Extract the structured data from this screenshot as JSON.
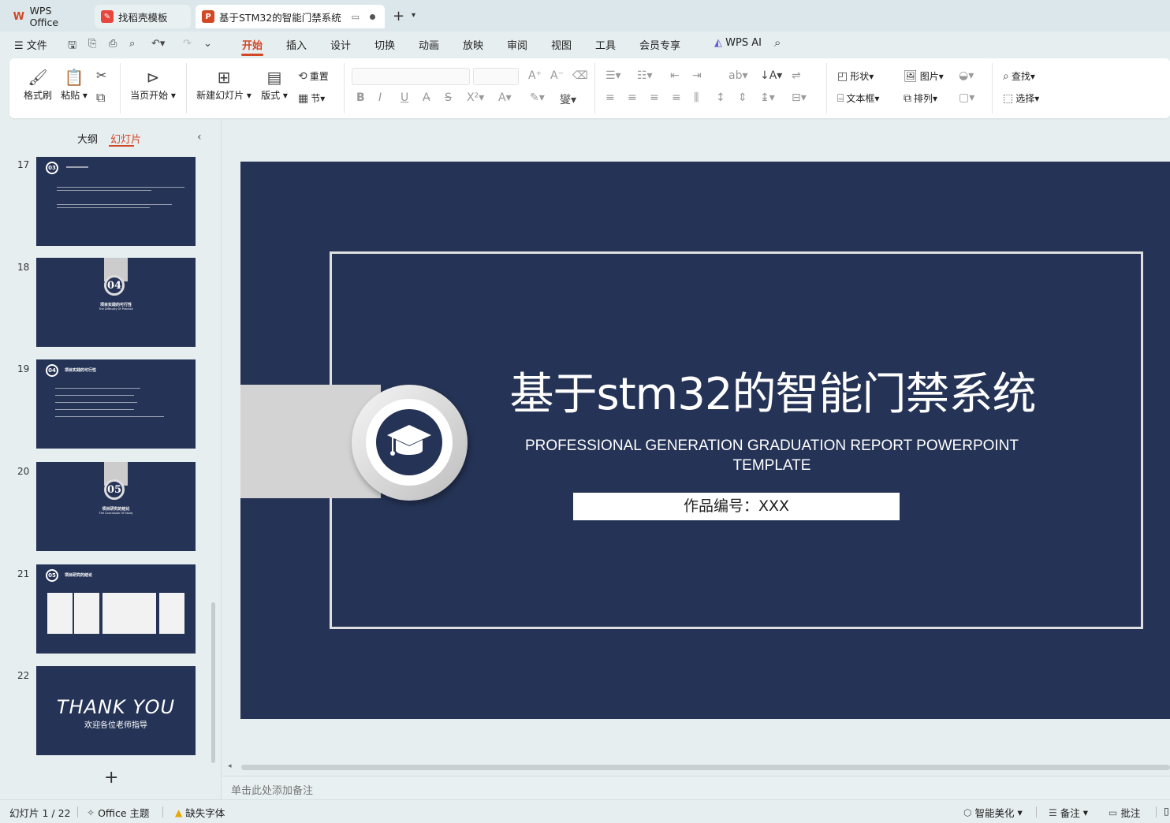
{
  "tabs": [
    {
      "label": "WPS Office"
    },
    {
      "label": "找稻壳模板"
    },
    {
      "label": "基于STM32的智能门禁系统"
    }
  ],
  "menu": {
    "file": "文件",
    "items": [
      "开始",
      "插入",
      "设计",
      "切换",
      "动画",
      "放映",
      "审阅",
      "视图",
      "工具",
      "会员专享"
    ],
    "wps_ai": "WPS AI"
  },
  "ribbon": {
    "format_painter": "格式刷",
    "paste": "粘贴",
    "from_current": "当页开始",
    "new_slide": "新建幻灯片",
    "layout": "版式",
    "reset": "重置",
    "section": "节",
    "shape": "形状",
    "picture": "图片",
    "textbox": "文本框",
    "arrange": "排列",
    "find": "查找",
    "select": "选择"
  },
  "panel": {
    "tab_outline": "大纲",
    "tab_slides": "幻灯片",
    "slides": [
      {
        "num": "17",
        "badge": "03"
      },
      {
        "num": "18",
        "badge": "04",
        "title": "项目实践的可行性",
        "sub": "The Difficulty Of Practice"
      },
      {
        "num": "19",
        "badge": "04",
        "title": "项目实践的可行性"
      },
      {
        "num": "20",
        "badge": "05",
        "title": "项目研究的结论",
        "sub": "The Conclusion Of Study"
      },
      {
        "num": "21",
        "badge": "05",
        "title": "项目研究的结论"
      },
      {
        "num": "22",
        "thank": "THANK YOU",
        "thank_sub": "欢迎各位老师指导"
      }
    ]
  },
  "slide": {
    "title": "基于stm32的智能门禁系统",
    "subtitle": "PROFESSIONAL GENERATION GRADUATION REPORT POWERPOINT TEMPLATE",
    "work_id": "作品编号：XXX"
  },
  "notes_placeholder": "单击此处添加备注",
  "status": {
    "slide_count": "幻灯片 1 / 22",
    "theme": "Office 主题",
    "missing_font": "缺失字体",
    "beautify": "智能美化",
    "notes": "备注",
    "comments": "批注"
  }
}
